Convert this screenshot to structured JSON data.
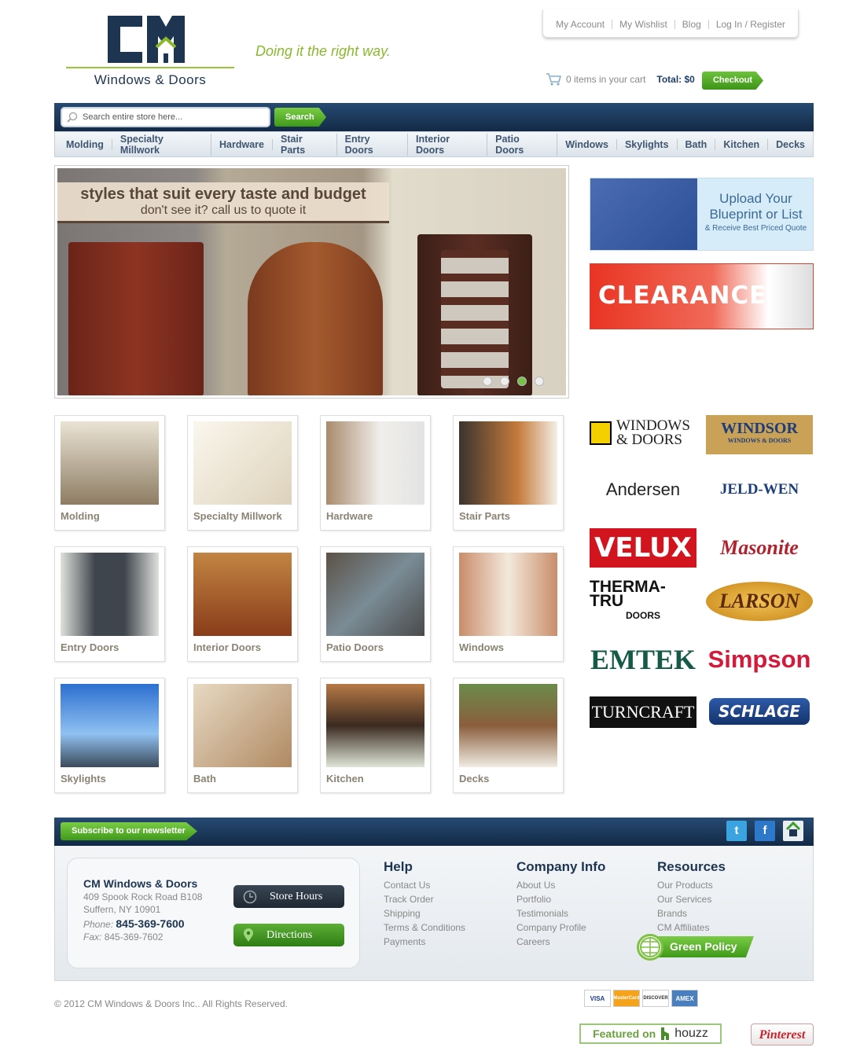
{
  "header": {
    "logo_mark": "CM",
    "logo_sub": "Windows & Doors",
    "tagline": "Doing it the right way.",
    "top_links": [
      "My Account",
      "My Wishlist",
      "Blog",
      "Log In / Register"
    ],
    "cart_text": "0 items in your cart",
    "cart_total": "Total: $0",
    "checkout": "Checkout"
  },
  "search": {
    "placeholder": "Search entire store here...",
    "button": "Search"
  },
  "nav": [
    "Molding",
    "Specialty Millwork",
    "Hardware",
    "Stair Parts",
    "Entry Doors",
    "Interior Doors",
    "Patio Doors",
    "Windows",
    "Skylights",
    "Bath",
    "Kitchen",
    "Decks"
  ],
  "slider": {
    "line1": "styles that suit every taste and budget",
    "line2": "don't see it? call us to quote it",
    "active_slide": 3,
    "slide_count": 4
  },
  "promo": {
    "blueprint_title": "Upload Your Blueprint or List",
    "blueprint_sub": "& Receive Best Priced Quote",
    "clearance": "CLEARANCE"
  },
  "brands": [
    "Pella Windows & Doors",
    "Windsor Windows & Doors",
    "Andersen",
    "Jeld-Wen",
    "Velux",
    "Masonite",
    "Therma-Tru Doors",
    "Larson",
    "Emtek",
    "Simpson",
    "Turncraft",
    "Schlage"
  ],
  "brand_text": {
    "pella_a": "WINDOWS",
    "pella_b": "& DOORS",
    "windsor": "WINDSOR",
    "windsor_sub": "WINDOWS & DOORS",
    "andersen": "Andersen",
    "jeldwen": "JELD-WEN",
    "velux": "VELUX",
    "masonite": "Masonite",
    "therma": "THERMA-TRU",
    "therma_sub": "DOORS",
    "larson": "LARSON",
    "emtek": "EMTEK",
    "simpson": "Simpson",
    "turncraft": "TURNCRAFT",
    "schlage": "SCHLAGE"
  },
  "products": [
    "Molding",
    "Specialty Millwork",
    "Hardware",
    "Stair Parts",
    "Entry Doors",
    "Interior Doors",
    "Patio Doors",
    "Windows",
    "Skylights",
    "Bath",
    "Kitchen",
    "Decks"
  ],
  "footer": {
    "subscribe": "Subscribe to our newsletter",
    "company": "CM Windows & Doors",
    "address1": "409 Spook Rock Road B108",
    "address2": "Suffern, NY 10901",
    "phone_label": "Phone:",
    "phone": "845-369-7600",
    "fax_label": "Fax:",
    "fax": "845-369-7602",
    "store_hours": "Store Hours",
    "directions": "Directions",
    "help_title": "Help",
    "help": [
      "Contact Us",
      "Track Order",
      "Shipping",
      "Terms & Conditions",
      "Payments"
    ],
    "company_title": "Company Info",
    "company_links": [
      "About Us",
      "Portfolio",
      "Testimonials",
      "Company Profile",
      "Careers"
    ],
    "resources_title": "Resources",
    "resources": [
      "Our Products",
      "Our Services",
      "Brands",
      "CM Affiliates"
    ],
    "green_policy": "Green Policy",
    "copyright": "© 2012 CM Windows & Doors Inc.. All Rights Reserved.",
    "cards": [
      "VISA",
      "MasterCard",
      "DISCOVER",
      "AMEX"
    ],
    "houzz_prefix": "Featured on",
    "houzz": "houzz",
    "pinterest": "Pinterest"
  }
}
